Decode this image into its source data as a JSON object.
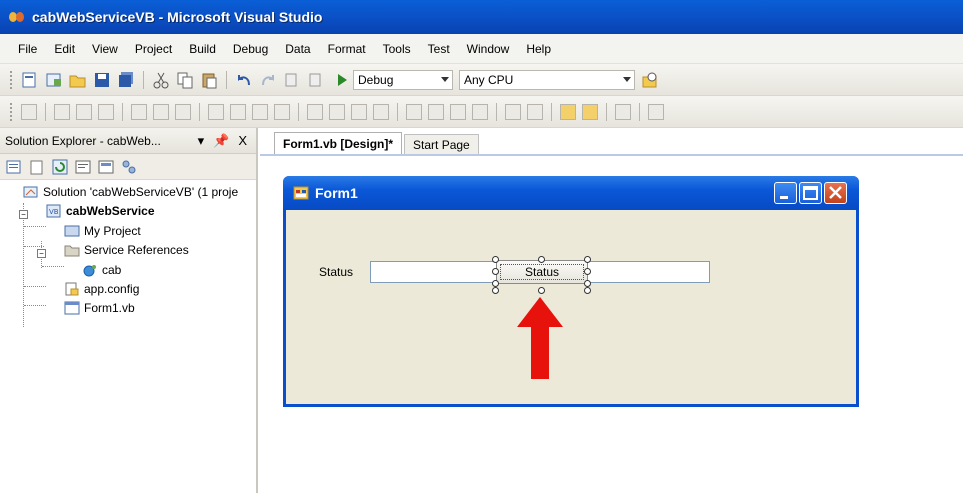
{
  "window": {
    "title": "cabWebServiceVB - Microsoft Visual Studio"
  },
  "menu": [
    "File",
    "Edit",
    "View",
    "Project",
    "Build",
    "Debug",
    "Data",
    "Format",
    "Tools",
    "Test",
    "Window",
    "Help"
  ],
  "toolbar": {
    "config_select": "Debug",
    "platform_select": "Any CPU"
  },
  "solution_explorer": {
    "title": "Solution Explorer - cabWeb...",
    "pin_label": "━",
    "close_label": "X",
    "items": {
      "solution": "Solution 'cabWebServiceVB' (1 proje",
      "project": "cabWebService",
      "my_project": "My Project",
      "service_refs": "Service References",
      "cab": "cab",
      "app_config": "app.config",
      "form1": "Form1.vb"
    }
  },
  "tabs": [
    {
      "label": "Form1.vb [Design]*"
    },
    {
      "label": "Start Page"
    }
  ],
  "form": {
    "title": "Form1",
    "status_label": "Status",
    "button_label": "Status"
  },
  "colors": {
    "titlebar": "#0b4fc5",
    "form_title": "#0a58d8",
    "arrow": "#e8120c"
  }
}
